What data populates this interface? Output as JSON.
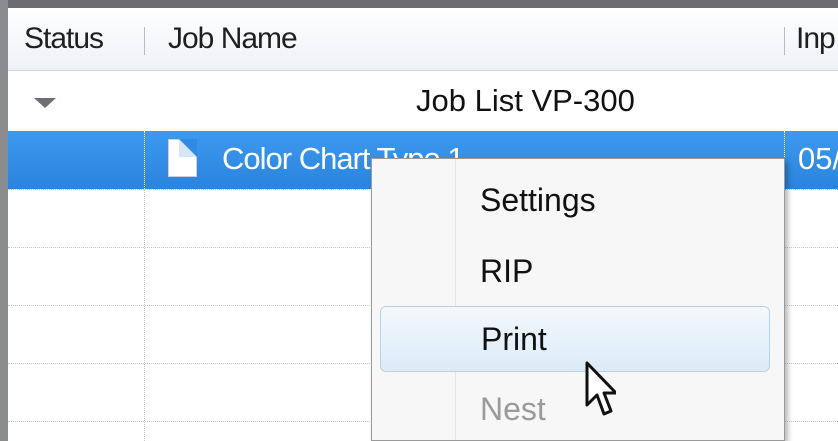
{
  "table": {
    "columns": {
      "status": "Status",
      "job_name": "Job Name",
      "input": "Inp"
    },
    "group": {
      "title": "Job List VP-300"
    },
    "selected_row": {
      "job_name": "Color Chart Type 1",
      "input_value": "05/"
    }
  },
  "context_menu": {
    "items": [
      {
        "label": "Settings",
        "enabled": true
      },
      {
        "label": "RIP",
        "enabled": true
      },
      {
        "label": "Print",
        "enabled": true,
        "highlighted": true
      },
      {
        "label": "Nest",
        "enabled": false
      }
    ]
  },
  "icons": {
    "group_toggle": "triangle-down-icon",
    "job_file": "document-icon",
    "pointer": "mouse-pointer-icon"
  },
  "colors": {
    "selection": "#2f8be0",
    "menu_highlight": "#dcebf8",
    "disabled_text": "#9a9a9a"
  }
}
